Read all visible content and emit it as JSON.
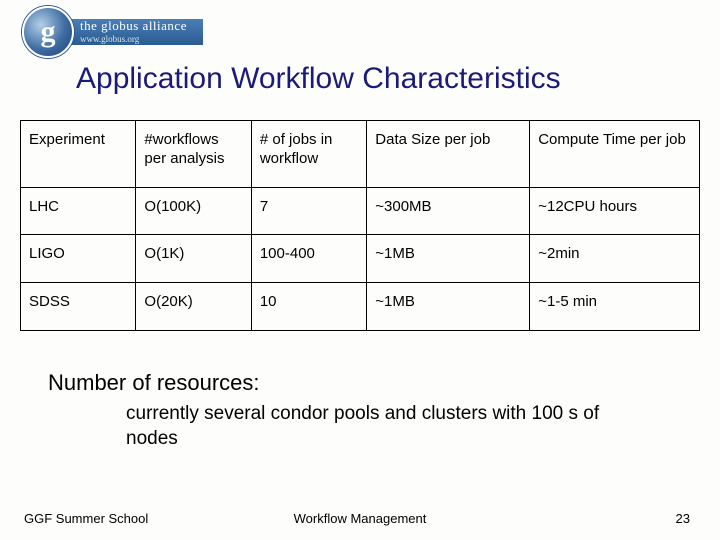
{
  "logo": {
    "glyph": "g",
    "banner_top": "the globus alliance",
    "banner_sub": "www.globus.org"
  },
  "title": "Application Workflow Characteristics",
  "table": {
    "headers": [
      "Experiment",
      "#workflows per analysis",
      "# of jobs in workflow",
      "Data Size per job",
      "Compute Time per job"
    ],
    "rows": [
      {
        "c1": "LHC",
        "c2": "O(100K)",
        "c3": "7",
        "c4": "~300MB",
        "c5": "~12CPU hours"
      },
      {
        "c1": "LIGO",
        "c2": "O(1K)",
        "c3": "100-400",
        "c4": "~1MB",
        "c5": "~2min"
      },
      {
        "c1": "SDSS",
        "c2": "O(20K)",
        "c3": "10",
        "c4": "~1MB",
        "c5": "~1-5 min"
      }
    ]
  },
  "body": {
    "lead": "Number of resources:",
    "sub": "currently several condor pools and clusters with 100 s of nodes"
  },
  "footer": {
    "left": "GGF Summer School",
    "center": "Workflow Management",
    "right": "23"
  }
}
